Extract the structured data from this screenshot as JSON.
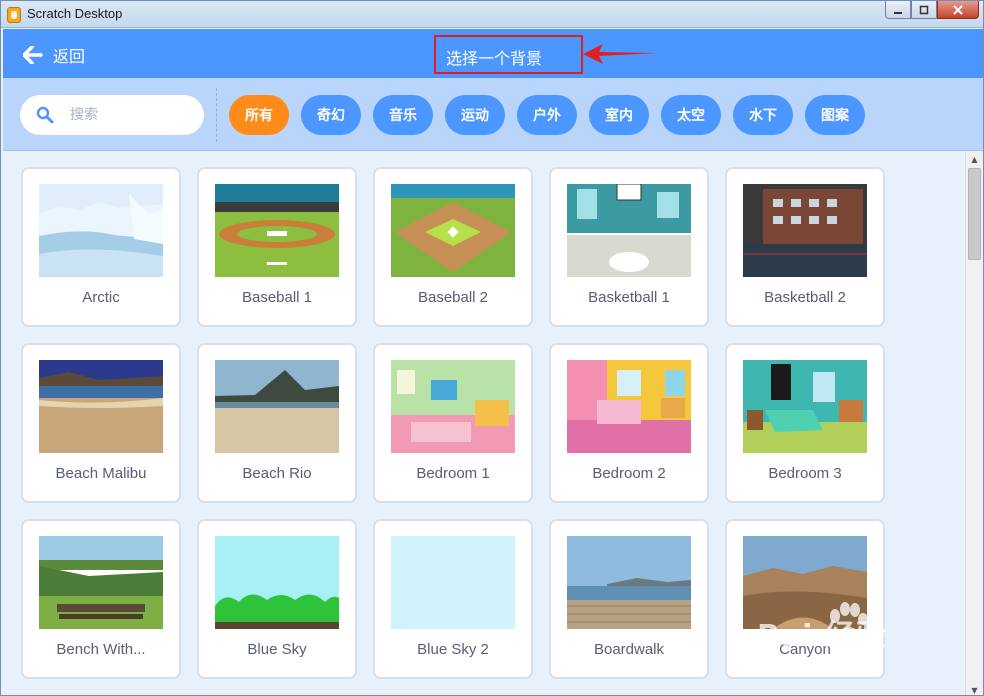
{
  "window": {
    "title": "Scratch Desktop"
  },
  "header": {
    "back_label": "返回",
    "title": "选择一个背景"
  },
  "search": {
    "placeholder": "搜索",
    "value": ""
  },
  "tags": [
    {
      "label": "所有",
      "active": true
    },
    {
      "label": "奇幻",
      "active": false
    },
    {
      "label": "音乐",
      "active": false
    },
    {
      "label": "运动",
      "active": false
    },
    {
      "label": "户外",
      "active": false
    },
    {
      "label": "室内",
      "active": false
    },
    {
      "label": "太空",
      "active": false
    },
    {
      "label": "水下",
      "active": false
    },
    {
      "label": "图案",
      "active": false
    }
  ],
  "backdrops": [
    {
      "name": "Arctic",
      "icon": "arctic-thumbnail"
    },
    {
      "name": "Baseball 1",
      "icon": "baseball-1-thumbnail"
    },
    {
      "name": "Baseball 2",
      "icon": "baseball-2-thumbnail"
    },
    {
      "name": "Basketball 1",
      "icon": "basketball-1-thumbnail"
    },
    {
      "name": "Basketball 2",
      "icon": "basketball-2-thumbnail"
    },
    {
      "name": "Beach Malibu",
      "icon": "beach-malibu-thumbnail"
    },
    {
      "name": "Beach Rio",
      "icon": "beach-rio-thumbnail"
    },
    {
      "name": "Bedroom 1",
      "icon": "bedroom-1-thumbnail"
    },
    {
      "name": "Bedroom 2",
      "icon": "bedroom-2-thumbnail"
    },
    {
      "name": "Bedroom 3",
      "icon": "bedroom-3-thumbnail"
    },
    {
      "name": "Bench With...",
      "icon": "bench-thumbnail"
    },
    {
      "name": "Blue Sky",
      "icon": "blue-sky-thumbnail"
    },
    {
      "name": "Blue Sky 2",
      "icon": "blue-sky-2-thumbnail"
    },
    {
      "name": "Boardwalk",
      "icon": "boardwalk-thumbnail"
    },
    {
      "name": "Canyon",
      "icon": "canyon-thumbnail"
    }
  ],
  "watermark": {
    "text": "Bai 经验",
    "url": "jingyan.baidu.com"
  },
  "colors": {
    "header": "#4c97ff",
    "filterbar": "#b9d5fb",
    "active_tag": "#ff8c1a",
    "tag": "#4c97ff",
    "annotation": "#e02020"
  }
}
